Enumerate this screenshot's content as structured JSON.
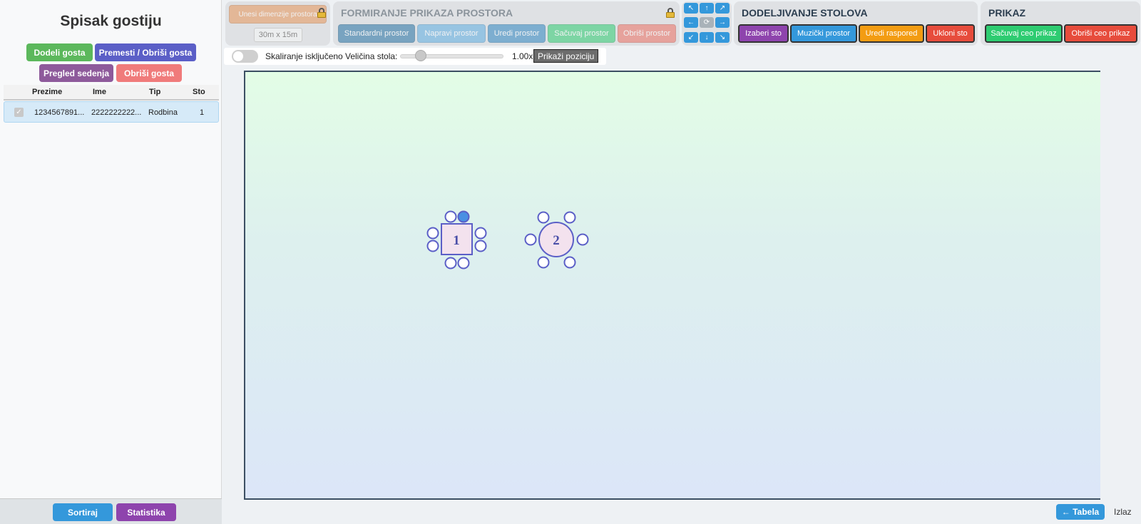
{
  "sidebar": {
    "title": "Spisak gostiju",
    "buttons": {
      "assign": "Dodeli gosta",
      "move_delete": "Premesti / Obriši gosta",
      "seating_view": "Pregled sedenja",
      "delete_guest": "Obriši gosta"
    },
    "columns": [
      "Prezime",
      "Ime",
      "Tip",
      "Sto"
    ],
    "guests": [
      {
        "checked": true,
        "prezime": "1234567891...",
        "ime": "2222222222...",
        "tip": "Rodbina",
        "sto": "1"
      }
    ],
    "footer": {
      "sort": "Sortiraj",
      "stats": "Statistika"
    }
  },
  "toolbar": {
    "dimensions": {
      "button": "Unesi dimenzije prostora",
      "value": "30m x 15m"
    },
    "forming": {
      "title": "FORMIRANJE PRIKAZA PROSTORA",
      "buttons": [
        "Standardni prostor",
        "Napravi prostor",
        "Uredi prostor",
        "Sačuvaj prostor",
        "Obriši prostor"
      ]
    },
    "arrows": [
      "↖",
      "↑",
      "↗",
      "←",
      "⟳",
      "→",
      "↙",
      "↓",
      "↘"
    ],
    "tables": {
      "title": "DODELJIVANJE STOLOVA",
      "buttons": [
        "Izaberi sto",
        "Muzički prostor",
        "Uredi raspored",
        "Ukloni sto"
      ]
    },
    "display": {
      "title": "PRIKAZ",
      "buttons": [
        "Sačuvaj ceo prikaz",
        "Obriši ceo prikaz"
      ]
    },
    "row2": {
      "scaling_label": "Skaliranje isključeno",
      "table_size_label": "Veličina stola:",
      "table_size_value": "1.00x",
      "table_size_level": 1.0,
      "show_positions": "Prikaži poziciju"
    }
  },
  "floor_plan": {
    "tables": [
      {
        "number": "1",
        "shape": "square",
        "seats": 8,
        "occupied_seats": 1
      },
      {
        "number": "2",
        "shape": "round",
        "seats": 6,
        "occupied_seats": 0
      }
    ]
  },
  "bottom": {
    "back_to_table": "← Tabela",
    "exit": "Izlaz"
  },
  "colors": {
    "green": "#5cb85c",
    "indigo": "#5b5fc7",
    "purple": "#8e44ad",
    "red": "#e74c3c",
    "blue": "#3498db",
    "orange": "#f39c12",
    "table_stroke": "#5b5fc7",
    "table_fill": "#f3e2ee",
    "seat_occupied": "#4a90e2"
  }
}
